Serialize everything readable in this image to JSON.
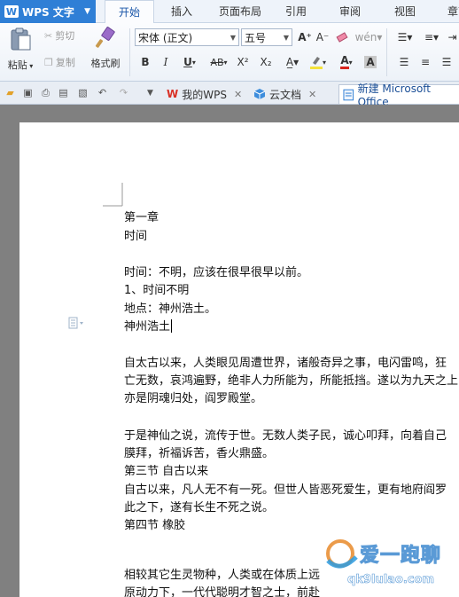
{
  "app": {
    "name": "WPS 文字",
    "logo_letter": "W"
  },
  "ribbon_tabs": [
    "开始",
    "插入",
    "页面布局",
    "引用",
    "审阅",
    "视图",
    "章节"
  ],
  "ribbon": {
    "paste_label": "粘贴",
    "cut_label": "剪切",
    "copy_label": "复制",
    "format_painter_label": "格式刷",
    "font_name": "宋体 (正文)",
    "font_size": "五号",
    "grow_font": "A⁺",
    "shrink_font": "A⁻",
    "bold": "B",
    "italic": "I",
    "underline": "U",
    "strikethrough": "AB",
    "superscript": "X²",
    "subscript": "X₂",
    "clear_format": "A",
    "font_color_label": "A"
  },
  "doc_tabs": [
    {
      "label": "我的WPS",
      "icon": "W"
    },
    {
      "label": "云文档",
      "icon": "cube"
    },
    {
      "label": "新建 Microsoft Office",
      "icon": "doc"
    }
  ],
  "document": {
    "lines": [
      "第一章",
      "时间",
      "",
      "时间：不明，应该在很早很早以前。",
      "1、时间不明",
      "地点：神州浩土。",
      " 神州浩土",
      "",
      "自太古以来，人类眼见周遭世界，诸般奇异之事，电闪雷鸣，狂",
      "亡无数，哀鸿遍野，绝非人力所能为，所能抵挡。遂以为九天之上",
      "亦是阴魂归处，阎罗殿堂。",
      "",
      "于是神仙之说，流传于世。无数人类子民，诚心叩拜，向着自己",
      "膜拜，祈福诉苦，香火鼎盛。",
      "第三节 自古以来",
      "自古以来，凡人无不有一死。但世人皆恶死爱生，更有地府阎罗",
      "此之下，遂有长生不死之说。",
      "第四节 橡胶",
      "",
      "",
      "相较其它生灵物种，人类或在体质上远",
      "原动力下，一代代聪明才智之士，前赴"
    ]
  },
  "watermark": {
    "site": "qk9lulao.com",
    "brand": "爱一跑聊"
  },
  "colors": {
    "accent": "#2f7fd6",
    "font_color": "#d8251d",
    "highlight": "#f5e23a"
  }
}
